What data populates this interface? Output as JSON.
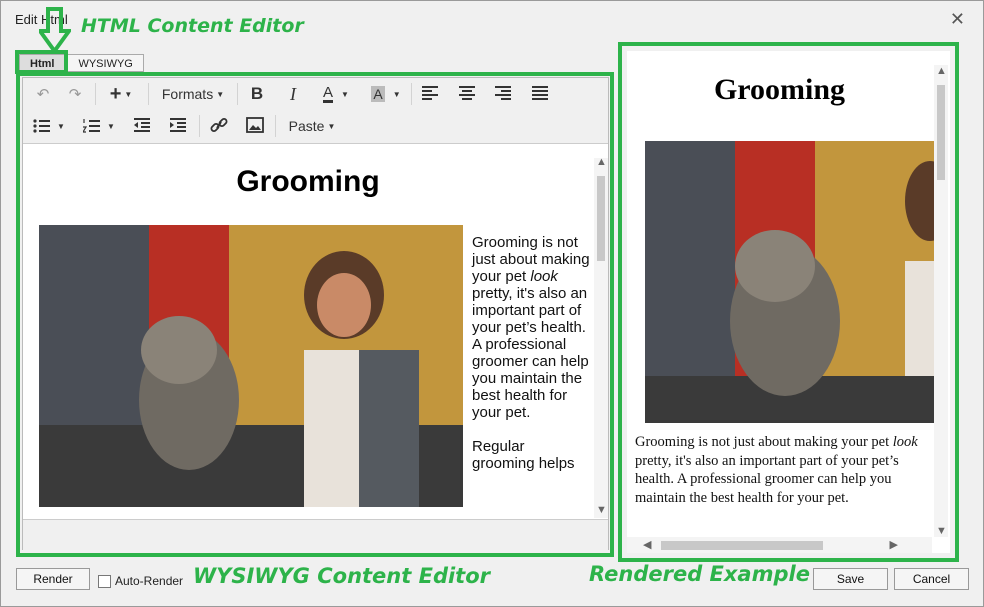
{
  "dialog": {
    "title": "Edit Html",
    "close_glyph": "✕"
  },
  "annotations": {
    "html_editor": "HTML Content Editor",
    "wysiwyg_editor": "WYSIWYG Content Editor",
    "rendered": "Rendered Example",
    "color": "#2db34a"
  },
  "tabs": [
    {
      "label": "Html",
      "active": true
    },
    {
      "label": "WYSIWYG",
      "active": false
    }
  ],
  "toolbar": {
    "undo": "↶",
    "redo": "↷",
    "insert": "+",
    "formats": "Formats",
    "bold": "B",
    "italic": "I",
    "font_color": "A",
    "bg_color": "A",
    "paste": "Paste"
  },
  "editor": {
    "heading": "Grooming",
    "paragraph1_part1": "Grooming is not just about making your pet ",
    "paragraph1_em": "look",
    "paragraph1_part2": " pretty, it's also an important part of your pet’s health.  A professional groomer can help you maintain the best health for your pet.",
    "paragraph2": "Regular grooming helps"
  },
  "preview": {
    "heading": "Grooming",
    "text_part1": "Grooming is not just about making your pet ",
    "text_em": "look",
    "text_part2": " pretty, it's also an important part of your pet’s health.  A professional groomer can help you maintain the best health for your pet."
  },
  "footer": {
    "render": "Render",
    "auto_render": "Auto-Render",
    "save": "Save",
    "cancel": "Cancel"
  }
}
